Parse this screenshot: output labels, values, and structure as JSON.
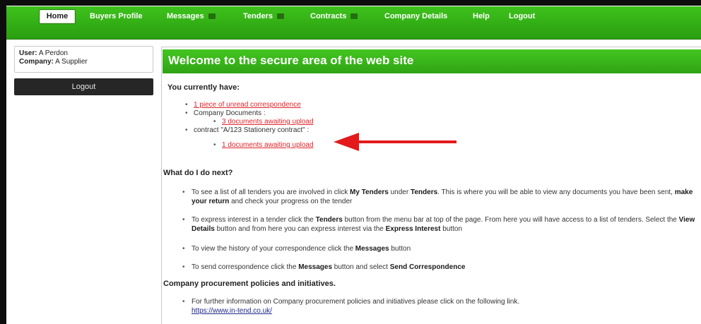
{
  "nav": {
    "home": "Home",
    "buyers_profile": "Buyers Profile",
    "messages": "Messages",
    "tenders": "Tenders",
    "contracts": "Contracts",
    "company_details": "Company Details",
    "help": "Help",
    "logout": "Logout"
  },
  "sidebar": {
    "user_label": "User:",
    "user_value": "A Perdon",
    "company_label": "Company:",
    "company_value": "A Supplier",
    "logout": "Logout"
  },
  "main": {
    "title": "Welcome to the secure area of the web site",
    "you_have": "You currently have:",
    "unread_link": "1 piece of unread correspondence",
    "company_documents": "Company Documents :",
    "company_docs_link": "3 documents awaiting upload",
    "contract_text": "contract \"A/123 Stationery contract\" :",
    "contract_docs_link": "1 documents awaiting upload",
    "next_heading": "What do I do next?",
    "next_items": [
      {
        "t1": "To see a list of all tenders you are involved in click ",
        "b1": "My Tenders",
        "t2": " under ",
        "b2": "Tenders",
        "t3": ". This is where you will be able to view any documents you have been sent, ",
        "b3": "make your return",
        "t4": " and check your progress on the tender"
      },
      {
        "t1": "To express interest in a tender click the ",
        "b1": "Tenders",
        "t2": " button from the menu bar at top of the page. From here you will have access to a list of tenders. Select the ",
        "b2": "View Details",
        "t3": " button and from here you can express interest via the ",
        "b3": "Express Interest",
        "t4": " button"
      },
      {
        "t1": "To view the history of your correspondence click the ",
        "b1": "Messages",
        "t2": " button"
      },
      {
        "t1": "To send correspondence click the ",
        "b1": "Messages",
        "t2": " button and select ",
        "b2": "Send Correspondence"
      }
    ],
    "policy_heading": "Company procurement policies and initiatives.",
    "policy_text": "For further information on Company procurement policies and initiatives please click on the following link.",
    "policy_link": "https://www.in-tend.co.uk/"
  },
  "colors": {
    "nav_green": "#36b418",
    "header_green": "#3cb81c",
    "link_red": "#e0252b",
    "arrow_red": "#e3191c"
  }
}
